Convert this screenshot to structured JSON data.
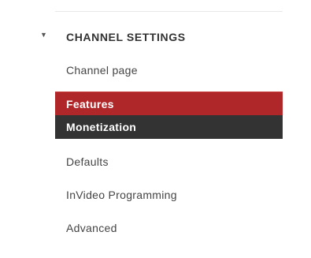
{
  "sidebar": {
    "section": {
      "title": "CHANNEL SETTINGS",
      "collapse_icon": "collapse-arrow-icon"
    },
    "items": [
      {
        "label": "Channel page",
        "state": "normal"
      },
      {
        "label": "Features",
        "state": "active"
      },
      {
        "label": "Monetization",
        "state": "dark"
      },
      {
        "label": "Defaults",
        "state": "normal"
      },
      {
        "label": "InVideo Programming",
        "state": "normal"
      },
      {
        "label": "Advanced",
        "state": "normal"
      }
    ]
  },
  "colors": {
    "active_bg": "#b0272a",
    "dark_bg": "#333333",
    "text": "#444444"
  }
}
